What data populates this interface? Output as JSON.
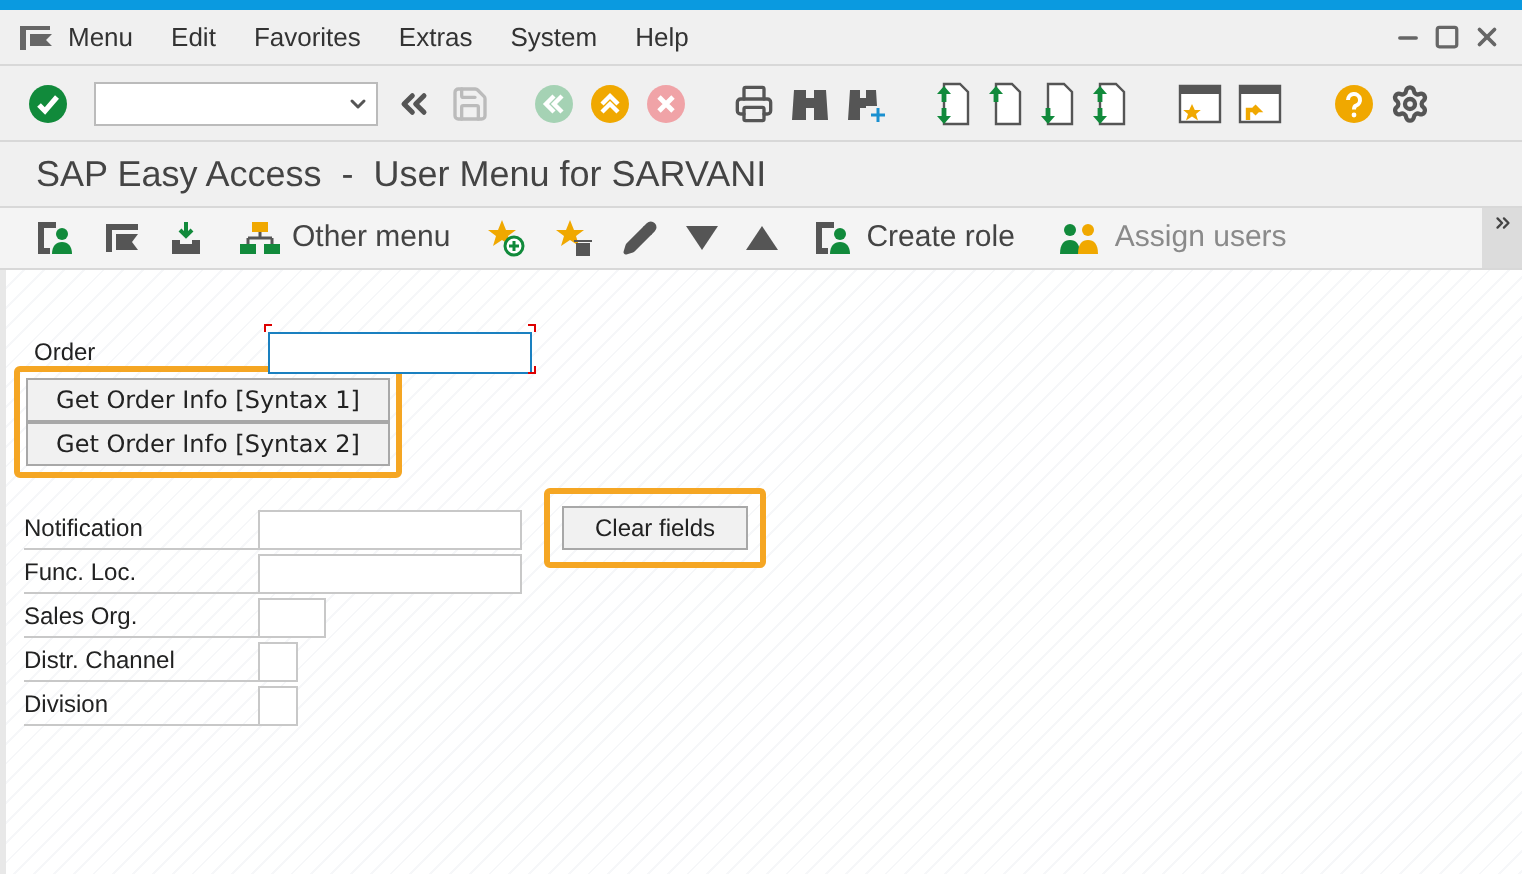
{
  "menu_bar": [
    {
      "label": "Menu"
    },
    {
      "label": "Edit"
    },
    {
      "label": "Favorites"
    },
    {
      "label": "Extras"
    },
    {
      "label": "System"
    },
    {
      "label": "Help"
    }
  ],
  "system_toolbar": {
    "buttons": [
      {
        "disabled": false
      },
      {
        "disabled": true
      },
      {
        "disabled": true
      },
      {
        "disabled": false
      },
      {
        "disabled": true
      }
    ]
  },
  "title": "SAP Easy Access  -  User Menu for SARVANI",
  "app_toolbar": [
    {
      "kind": "icon",
      "disabled": false
    },
    {
      "kind": "icon",
      "disabled": false
    },
    {
      "kind": "icon",
      "disabled": false
    },
    {
      "kind": "text",
      "label": "Other menu",
      "disabled": false
    },
    {
      "kind": "icon",
      "disabled": false
    },
    {
      "kind": "icon",
      "disabled": false
    },
    {
      "kind": "icon",
      "disabled": false
    },
    {
      "kind": "icon",
      "disabled": false
    },
    {
      "kind": "icon",
      "disabled": false
    },
    {
      "kind": "text",
      "label": "Create role",
      "disabled": false
    },
    {
      "kind": "text",
      "label": "Assign users",
      "disabled": true
    }
  ],
  "order": {
    "label": "Order",
    "required": true
  },
  "order_buttons": {
    "highlighted": true,
    "buttons": [
      "Get Order Info [Syntax 1]",
      "Get Order Info [Syntax 2]"
    ]
  },
  "fields": [
    {
      "label": "Notification"
    },
    {
      "label": "Func. Loc."
    },
    {
      "label": "Sales Org."
    },
    {
      "label": "Distr. Channel"
    },
    {
      "label": "Division"
    }
  ],
  "clear_button": {
    "label": "Clear fields",
    "highlighted": true
  }
}
